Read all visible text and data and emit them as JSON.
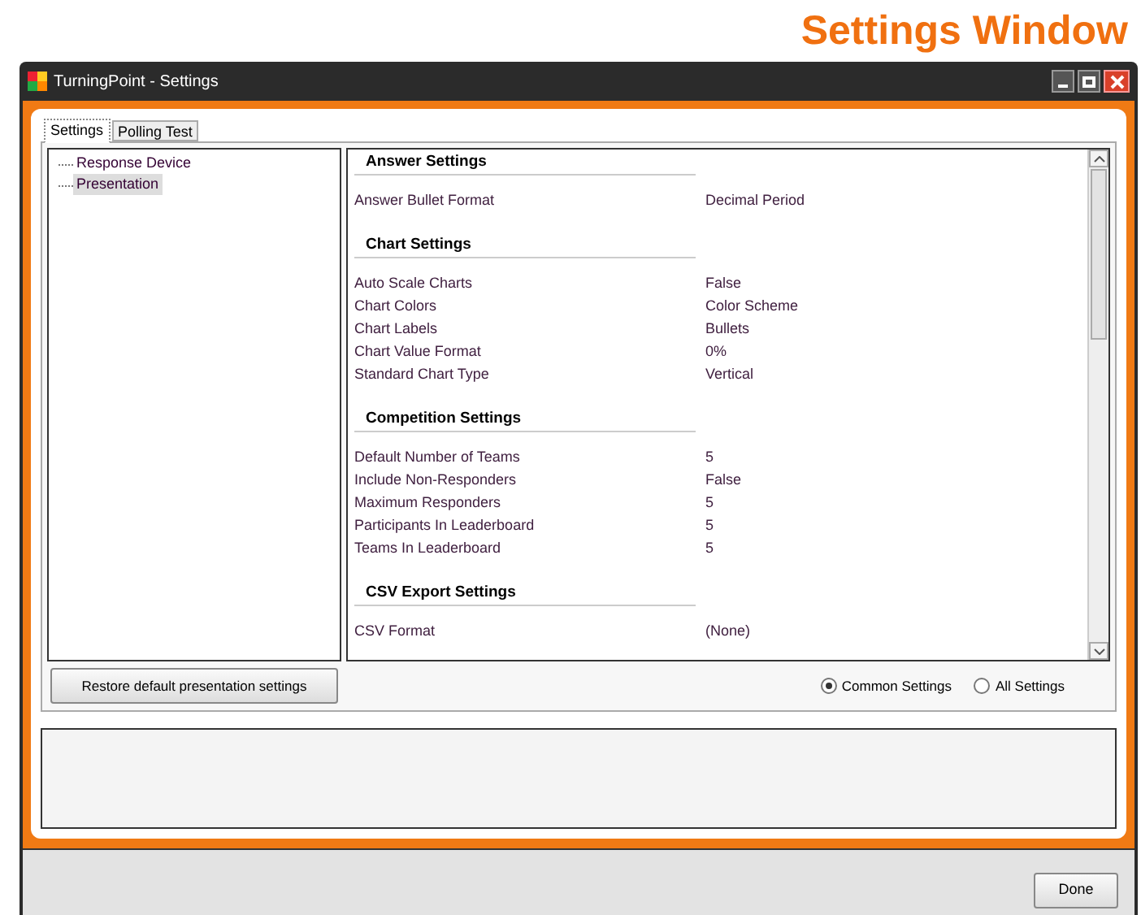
{
  "heading": "Settings Window",
  "window": {
    "title": "TurningPoint - Settings"
  },
  "tabs": [
    {
      "label": "Settings",
      "selected": true
    },
    {
      "label": "Polling Test",
      "selected": false
    }
  ],
  "tree": [
    {
      "label": "Response Device",
      "selected": false
    },
    {
      "label": "Presentation",
      "selected": true
    }
  ],
  "sections": [
    {
      "title": "Answer Settings",
      "rows": [
        {
          "name": "Answer Bullet Format",
          "value": "Decimal Period"
        }
      ]
    },
    {
      "title": "Chart Settings",
      "rows": [
        {
          "name": "Auto Scale Charts",
          "value": "False"
        },
        {
          "name": "Chart Colors",
          "value": "Color Scheme"
        },
        {
          "name": "Chart Labels",
          "value": "Bullets"
        },
        {
          "name": "Chart Value Format",
          "value": "0%"
        },
        {
          "name": "Standard Chart Type",
          "value": "Vertical"
        }
      ]
    },
    {
      "title": "Competition Settings",
      "rows": [
        {
          "name": "Default Number of Teams",
          "value": "5"
        },
        {
          "name": "Include Non-Responders",
          "value": "False"
        },
        {
          "name": "Maximum Responders",
          "value": "5"
        },
        {
          "name": "Participants In Leaderboard",
          "value": "5"
        },
        {
          "name": "Teams In Leaderboard",
          "value": "5"
        }
      ]
    },
    {
      "title": "CSV Export Settings",
      "rows": [
        {
          "name": "CSV Format",
          "value": "(None)"
        }
      ]
    }
  ],
  "restore_button": "Restore default presentation settings",
  "view_options": [
    {
      "label": "Common Settings",
      "selected": true
    },
    {
      "label": "All Settings",
      "selected": false
    }
  ],
  "done_button": "Done"
}
